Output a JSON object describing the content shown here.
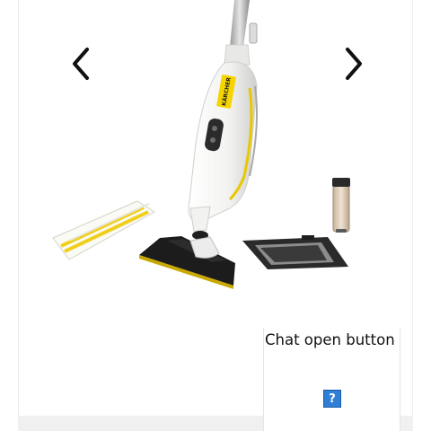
{
  "gallery": {
    "prev_icon": "chevron-left-icon",
    "next_icon": "chevron-right-icon",
    "image_subject": "steam-mop-with-accessories",
    "logo_text": "KÄRCHER"
  },
  "chat": {
    "label": "Chat open button",
    "help_glyph": "?",
    "help_icon": "question-mark-icon"
  },
  "colors": {
    "accent_yellow": "#f5d400",
    "body_white": "#f7f7f5",
    "dark": "#222222",
    "help_blue": "#2f7fd6"
  }
}
